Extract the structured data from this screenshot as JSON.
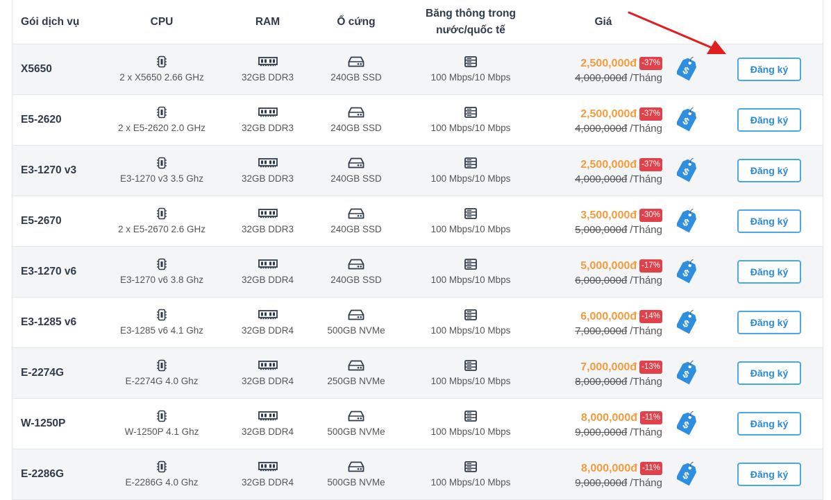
{
  "header": {
    "name": "Gói dịch vụ",
    "cpu": "CPU",
    "ram": "RAM",
    "disk": "Ổ cứng",
    "bandwidth_line1": "Băng thông trong",
    "bandwidth_line2": "nước/quốc tế",
    "price": "Giá"
  },
  "colors": {
    "accent": "#2b8ad6",
    "price": "#f39c3d",
    "discount": "#e0414a",
    "arrow": "#e02020",
    "tag": "#2e8fe0"
  },
  "icons": {
    "cpu": "cpu-icon",
    "ram": "memory-icon",
    "disk": "hard-drive-icon",
    "bandwidth": "server-icon",
    "tag": "price-tag-icon"
  },
  "per_label": "/Tháng",
  "plans": [
    {
      "name": "X5650",
      "cpu": "2 x X5650 2.66 GHz",
      "ram": "32GB DDR3",
      "disk": "240GB SSD",
      "bandwidth": "100 Mbps/10 Mbps",
      "price": "2,500,000đ",
      "discount": "-37%",
      "old_price": "4,000,000đ",
      "button": "Đăng ký"
    },
    {
      "name": "E5-2620",
      "cpu": "2 x E5-2620 2.0 GHz",
      "ram": "32GB DDR3",
      "disk": "240GB SSD",
      "bandwidth": "100 Mbps/10 Mbps",
      "price": "2,500,000đ",
      "discount": "-37%",
      "old_price": "4,000,000đ",
      "button": "Đăng ký"
    },
    {
      "name": "E3-1270 v3",
      "cpu": "E3-1270 v3 3.5 Ghz",
      "ram": "32GB DDR3",
      "disk": "240GB SSD",
      "bandwidth": "100 Mbps/10 Mbps",
      "price": "2,500,000đ",
      "discount": "-37%",
      "old_price": "4,000,000đ",
      "button": "Đăng ký"
    },
    {
      "name": "E5-2670",
      "cpu": "2 x E5-2670 2.6 GHz",
      "ram": "32GB DDR3",
      "disk": "240GB SSD",
      "bandwidth": "100 Mbps/10 Mbps",
      "price": "3,500,000đ",
      "discount": "-30%",
      "old_price": "5,000,000đ",
      "button": "Đăng ký"
    },
    {
      "name": "E3-1270 v6",
      "cpu": "E3-1270 v6 3.8 Ghz",
      "ram": "32GB DDR4",
      "disk": "240GB SSD",
      "bandwidth": "100 Mbps/10 Mbps",
      "price": "5,000,000đ",
      "discount": "-17%",
      "old_price": "6,000,000đ",
      "button": "Đăng ký"
    },
    {
      "name": "E3-1285 v6",
      "cpu": "E3-1285 v6 4.1 Ghz",
      "ram": "32GB DDR4",
      "disk": "500GB NVMe",
      "bandwidth": "100 Mbps/10 Mbps",
      "price": "6,000,000đ",
      "discount": "-14%",
      "old_price": "7,000,000đ",
      "button": "Đăng ký"
    },
    {
      "name": "E-2274G",
      "cpu": "E-2274G 4.0 Ghz",
      "ram": "32GB DDR4",
      "disk": "250GB NVMe",
      "bandwidth": "100 Mbps/10 Mbps",
      "price": "7,000,000đ",
      "discount": "-13%",
      "old_price": "8,000,000đ",
      "button": "Đăng ký"
    },
    {
      "name": "W-1250P",
      "cpu": "W-1250P 4.1 Ghz",
      "ram": "32GB DDR4",
      "disk": "500GB NVMe",
      "bandwidth": "100 Mbps/10 Mbps",
      "price": "8,000,000đ",
      "discount": "-11%",
      "old_price": "9,000,000đ",
      "button": "Đăng ký"
    },
    {
      "name": "E-2286G",
      "cpu": "E-2286G 4.0 Ghz",
      "ram": "32GB DDR4",
      "disk": "500GB NVMe",
      "bandwidth": "100 Mbps/10 Mbps",
      "price": "8,000,000đ",
      "discount": "-11%",
      "old_price": "9,000,000đ",
      "button": "Đăng ký"
    }
  ]
}
